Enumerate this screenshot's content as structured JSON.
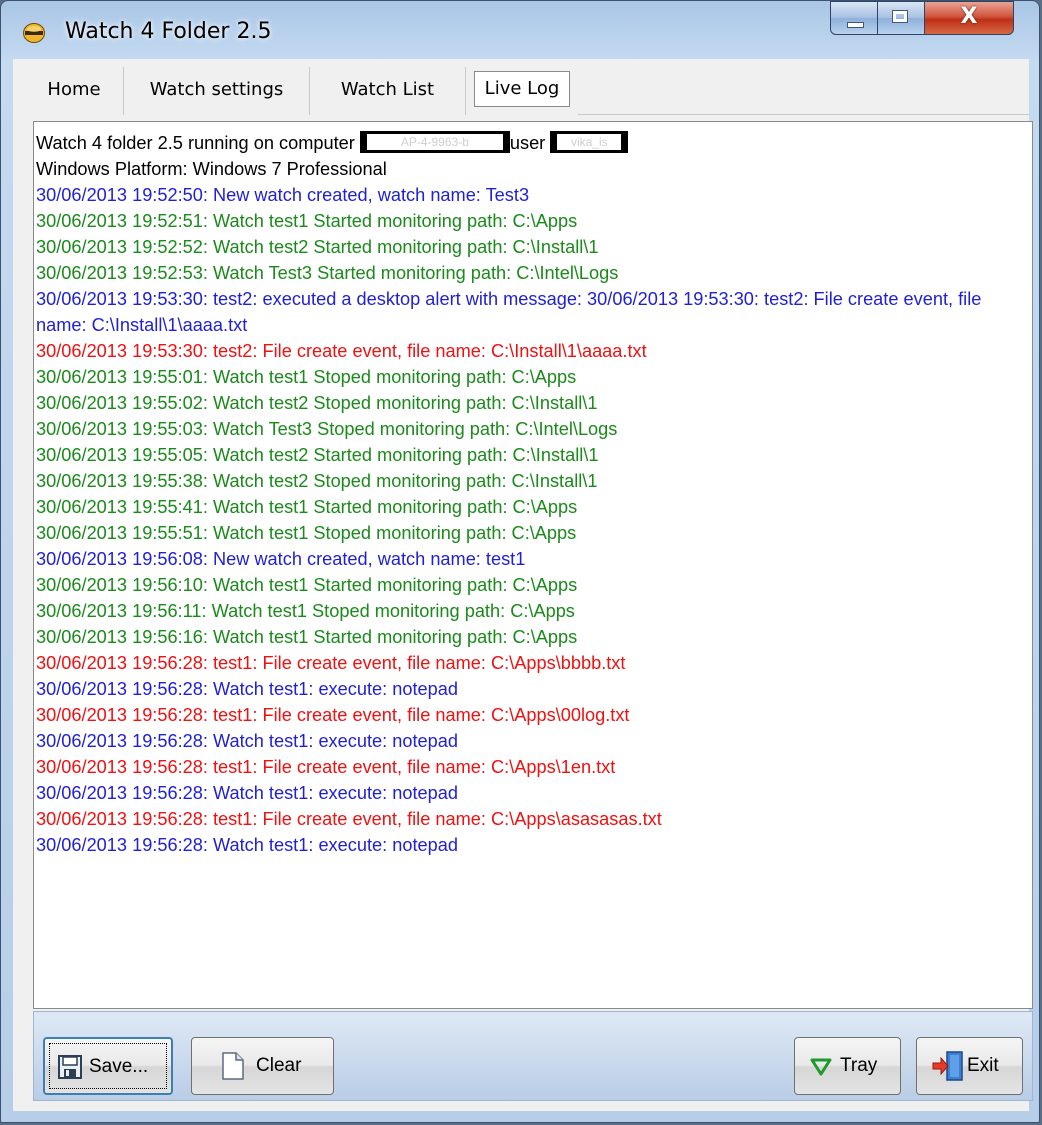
{
  "window": {
    "title": "Watch 4 Folder 2.5",
    "close_glyph": "X"
  },
  "tabs": [
    {
      "label": "Home"
    },
    {
      "label": "Watch settings"
    },
    {
      "label": "Watch List"
    },
    {
      "label": "Live Log",
      "active": true
    }
  ],
  "header_line": {
    "prefix": "Watch 4 folder 2.5 running on computer",
    "computer_redacted": "AP-4-9963-b",
    "mid": "user",
    "user_redacted": "vika_is"
  },
  "platform_line": "Windows Platform: Windows 7 Professional",
  "colors": {
    "info": "#1f1fd6",
    "monitor": "#1a8a1a",
    "event": "#ee1111",
    "header": "#000000"
  },
  "log": [
    {
      "kind": "info",
      "text": "30/06/2013 19:52:50: New watch created, watch name: Test3"
    },
    {
      "kind": "monitor",
      "text": "30/06/2013 19:52:51: Watch test1 Started monitoring path: C:\\Apps"
    },
    {
      "kind": "monitor",
      "text": "30/06/2013 19:52:52: Watch test2 Started monitoring path: C:\\Install\\1"
    },
    {
      "kind": "monitor",
      "text": "30/06/2013 19:52:53: Watch Test3 Started monitoring path: C:\\Intel\\Logs"
    },
    {
      "kind": "info",
      "text": "30/06/2013 19:53:30: test2: executed a desktop alert with message: 30/06/2013 19:53:30: test2: File create event, file name: C:\\Install\\1\\aaaa.txt"
    },
    {
      "kind": "event",
      "text": "30/06/2013 19:53:30: test2: File create event, file name: C:\\Install\\1\\aaaa.txt"
    },
    {
      "kind": "monitor",
      "text": "30/06/2013 19:55:01: Watch test1 Stoped monitoring path: C:\\Apps"
    },
    {
      "kind": "monitor",
      "text": "30/06/2013 19:55:02: Watch test2 Stoped monitoring path: C:\\Install\\1"
    },
    {
      "kind": "monitor",
      "text": "30/06/2013 19:55:03: Watch Test3 Stoped monitoring path: C:\\Intel\\Logs"
    },
    {
      "kind": "monitor",
      "text": "30/06/2013 19:55:05: Watch test2 Started monitoring path: C:\\Install\\1"
    },
    {
      "kind": "monitor",
      "text": "30/06/2013 19:55:38: Watch test2 Stoped monitoring path: C:\\Install\\1"
    },
    {
      "kind": "monitor",
      "text": "30/06/2013 19:55:41: Watch test1 Started monitoring path: C:\\Apps"
    },
    {
      "kind": "monitor",
      "text": "30/06/2013 19:55:51: Watch test1 Stoped monitoring path: C:\\Apps"
    },
    {
      "kind": "info",
      "text": "30/06/2013 19:56:08: New watch created, watch name: test1"
    },
    {
      "kind": "monitor",
      "text": "30/06/2013 19:56:10: Watch test1 Started monitoring path: C:\\Apps"
    },
    {
      "kind": "monitor",
      "text": "30/06/2013 19:56:11: Watch test1 Stoped monitoring path: C:\\Apps"
    },
    {
      "kind": "monitor",
      "text": "30/06/2013 19:56:16: Watch test1 Started monitoring path: C:\\Apps"
    },
    {
      "kind": "event",
      "text": "30/06/2013 19:56:28: test1: File create event, file name: C:\\Apps\\bbbb.txt"
    },
    {
      "kind": "info",
      "text": "30/06/2013 19:56:28: Watch test1: execute: notepad"
    },
    {
      "kind": "event",
      "text": "30/06/2013 19:56:28: test1: File create event, file name: C:\\Apps\\00log.txt"
    },
    {
      "kind": "info",
      "text": "30/06/2013 19:56:28: Watch test1: execute: notepad"
    },
    {
      "kind": "event",
      "text": "30/06/2013 19:56:28: test1: File create event, file name: C:\\Apps\\1en.txt"
    },
    {
      "kind": "info",
      "text": "30/06/2013 19:56:28: Watch test1: execute: notepad"
    },
    {
      "kind": "event",
      "text": "30/06/2013 19:56:28: test1: File create event, file name: C:\\Apps\\asasasas.txt"
    },
    {
      "kind": "info",
      "text": "30/06/2013 19:56:28: Watch test1: execute: notepad"
    }
  ],
  "buttons": {
    "save": {
      "label": "Save...",
      "icon": "floppy-icon"
    },
    "clear": {
      "label": "Clear",
      "icon": "blank-page-icon"
    },
    "tray": {
      "label": "Tray",
      "icon": "triangle-down-icon"
    },
    "exit": {
      "label": "Exit",
      "icon": "exit-door-icon"
    }
  }
}
